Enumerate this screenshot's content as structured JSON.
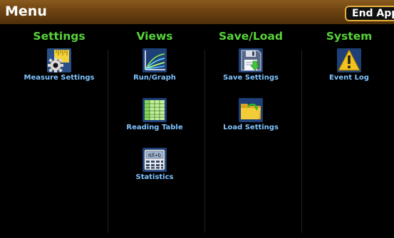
{
  "header": {
    "title": "Menu",
    "end_app": "End App"
  },
  "columns": [
    {
      "heading": "Settings",
      "items": [
        {
          "label": "Measure Settings",
          "icon": "measure-settings-icon"
        }
      ]
    },
    {
      "heading": "Views",
      "items": [
        {
          "label": "Run/Graph",
          "icon": "graph-icon"
        },
        {
          "label": "Reading Table",
          "icon": "table-icon"
        },
        {
          "label": "Statistics",
          "icon": "calculator-icon"
        }
      ]
    },
    {
      "heading": "Save/Load",
      "items": [
        {
          "label": "Save Settings",
          "icon": "floppy-disk-icon"
        },
        {
          "label": "Load Settings",
          "icon": "folder-icon"
        }
      ]
    },
    {
      "heading": "System",
      "items": [
        {
          "label": "Event Log",
          "icon": "warning-icon"
        }
      ]
    }
  ],
  "calculator_display": "mX+b",
  "colors": {
    "heading": "#57d43a",
    "label": "#7fc4ff",
    "header_bg": "#6e4312",
    "end_app_border": "#e6b23a"
  }
}
